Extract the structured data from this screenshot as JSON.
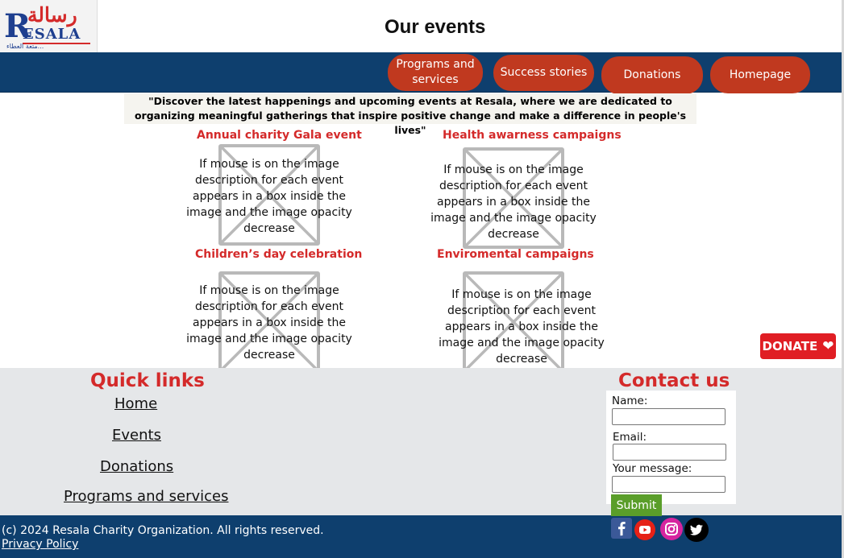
{
  "logo": {
    "arabic_name": "رسالة",
    "latin_name": "ESALA",
    "latin_initial": "R",
    "tagline": "متعة العطاء..."
  },
  "page_title": "Our events",
  "nav": {
    "items": [
      {
        "label": "Programs and services"
      },
      {
        "label": "Success stories"
      },
      {
        "label": "Donations"
      },
      {
        "label": "Homepage"
      }
    ]
  },
  "intro_quote": "\"Discover the latest happenings and upcoming events at Resala, where we are dedicated to organizing meaningful gatherings that inspire positive change and make a difference in people's lives\"",
  "events": [
    {
      "title": "Annual charity Gala event",
      "description": "If mouse is on the image description for each event appears in a box inside the image and the image opacity decrease"
    },
    {
      "title": "Health awarness campaigns",
      "description": "If mouse is on the image description for each event appears in a box inside the image and the image opacity decrease"
    },
    {
      "title": "Children’s day celebration",
      "description": "If mouse is on the image description for each event appears in a box inside the image and the image opacity decrease"
    },
    {
      "title": "Enviromental campaigns",
      "description": "If mouse is on the image description for each event appears in a box inside the image and the image opacity decrease"
    }
  ],
  "donate_float": {
    "label": "DONATE"
  },
  "footer": {
    "quick_links_title": "Quick links",
    "quick_links": [
      "Home",
      "Events",
      "Donations",
      "Programs and services"
    ],
    "contact_title": "Contact us",
    "form": {
      "name_label": "Name:",
      "email_label": "Email:",
      "message_label": "Your message:",
      "submit_label": "Submit"
    },
    "copyright": "(c) 2024 Resala Charity Organization. All rights reserved.",
    "privacy_label": "Privacy Policy",
    "social_icons": [
      "facebook-icon",
      "youtube-icon",
      "instagram-icon",
      "twitter-icon"
    ]
  },
  "colors": {
    "nav_bar": "#0e3f6e",
    "nav_button": "#c0391f",
    "accent_red": "#d42a2a",
    "footer_bg": "#e5e7e9",
    "submit_green": "#5a9e2a",
    "donate_red": "#e01e24"
  }
}
